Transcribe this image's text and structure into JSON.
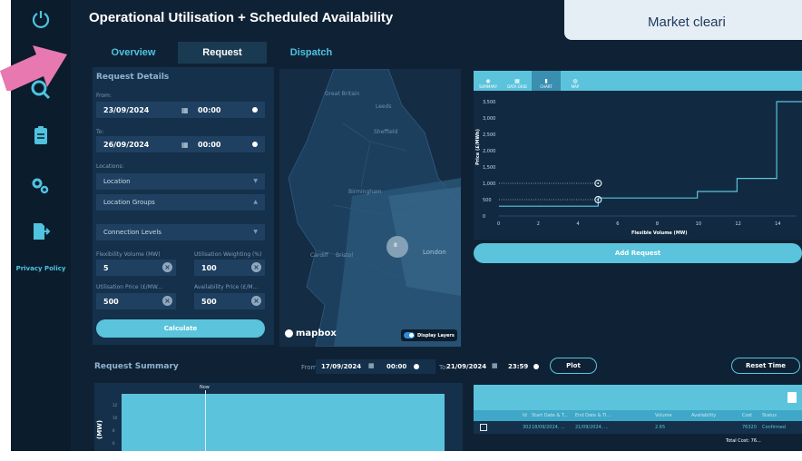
{
  "app": {
    "title": "Operational Utilisation + Scheduled Availability",
    "privacy_label": "Privacy Policy"
  },
  "banner": {
    "text": "Market cleari"
  },
  "tabs": [
    {
      "label": "Overview"
    },
    {
      "label": "Request"
    },
    {
      "label": "Dispatch"
    }
  ],
  "request_details": {
    "title": "Request Details",
    "from_label": "From:",
    "from_date": "23/09/2024",
    "from_time": "00:00",
    "to_label": "To:",
    "to_date": "26/09/2024",
    "to_time": "00:00",
    "locations_label": "Locations:",
    "location": "Location",
    "location_groups": "Location Groups",
    "connection_levels": "Connection Levels",
    "flex_volume_label": "Flexibility Volume (MW)",
    "flex_volume": "5",
    "util_weighting_label": "Utilisation Weighting (%)",
    "util_weighting": "100",
    "util_price_label": "Utilisation Price (£/MW...",
    "util_price": "500",
    "avail_price_label": "Availability Price (£/M...",
    "avail_price": "500",
    "calculate": "Calculate"
  },
  "map": {
    "labels": {
      "great_britain": "Great Britain",
      "leeds": "Leeds",
      "sheffield": "Sheffield",
      "birmingham": "Birmingham",
      "cardiff": "Cardiff",
      "bristol": "Bristol",
      "london": "London"
    },
    "cluster_count": "8",
    "logo": "mapbox",
    "display_layers": "Display Layers"
  },
  "chart_panel": {
    "tabs": [
      {
        "label": "SUMMARY",
        "icon": "eye-icon"
      },
      {
        "label": "DATA GRID",
        "icon": "grid-icon"
      },
      {
        "label": "CHART",
        "icon": "chart-icon"
      },
      {
        "label": "MAP",
        "icon": "globe-icon"
      }
    ],
    "add_request": "Add Request"
  },
  "chart_data": {
    "type": "line",
    "title": "",
    "xlabel": "Flexible Volume (MW)",
    "ylabel": "Price (£/MWh)",
    "xlim": [
      0,
      15
    ],
    "ylim": [
      0,
      3500
    ],
    "x_ticks": [
      "0",
      "2",
      "4",
      "6",
      "8",
      "10",
      "12",
      "14"
    ],
    "y_ticks": [
      "0",
      "500",
      "1,000",
      "1,500",
      "2,000",
      "2,500",
      "3,000",
      "3,500"
    ],
    "series": [
      {
        "x": [
          0,
          5,
          5,
          10,
          10,
          12,
          12,
          14,
          14,
          15.5
        ],
        "y": [
          300,
          300,
          550,
          550,
          750,
          750,
          1150,
          1150,
          3500,
          3500
        ]
      }
    ],
    "markers": [
      {
        "x": 5,
        "y": 1000
      },
      {
        "x": 5,
        "y": 500
      }
    ],
    "grid": false
  },
  "request_summary": {
    "title": "Request Summary",
    "from_label": "From:",
    "from_date": "17/09/2024",
    "from_time": "00:00",
    "to_label": "To:",
    "to_date": "21/09/2024",
    "to_time": "23:59",
    "plot": "Plot",
    "reset_time": "Reset Time",
    "now_label": "Now",
    "y_axis_label": "(MW)",
    "y_ticks": [
      "12",
      "10",
      "8",
      "6"
    ]
  },
  "table": {
    "headers": [
      "Id",
      "Start Date & T...",
      "End Date & Ti...",
      "Volume",
      "Availability",
      "Cost",
      "Status"
    ],
    "row": {
      "id": "302",
      "start": "18/09/2024, ...",
      "end": "21/09/2024, ...",
      "volume": "2.65",
      "availability": "",
      "cost": "76320",
      "status": "Confirmed"
    },
    "total": "Total Cost: 76..."
  }
}
